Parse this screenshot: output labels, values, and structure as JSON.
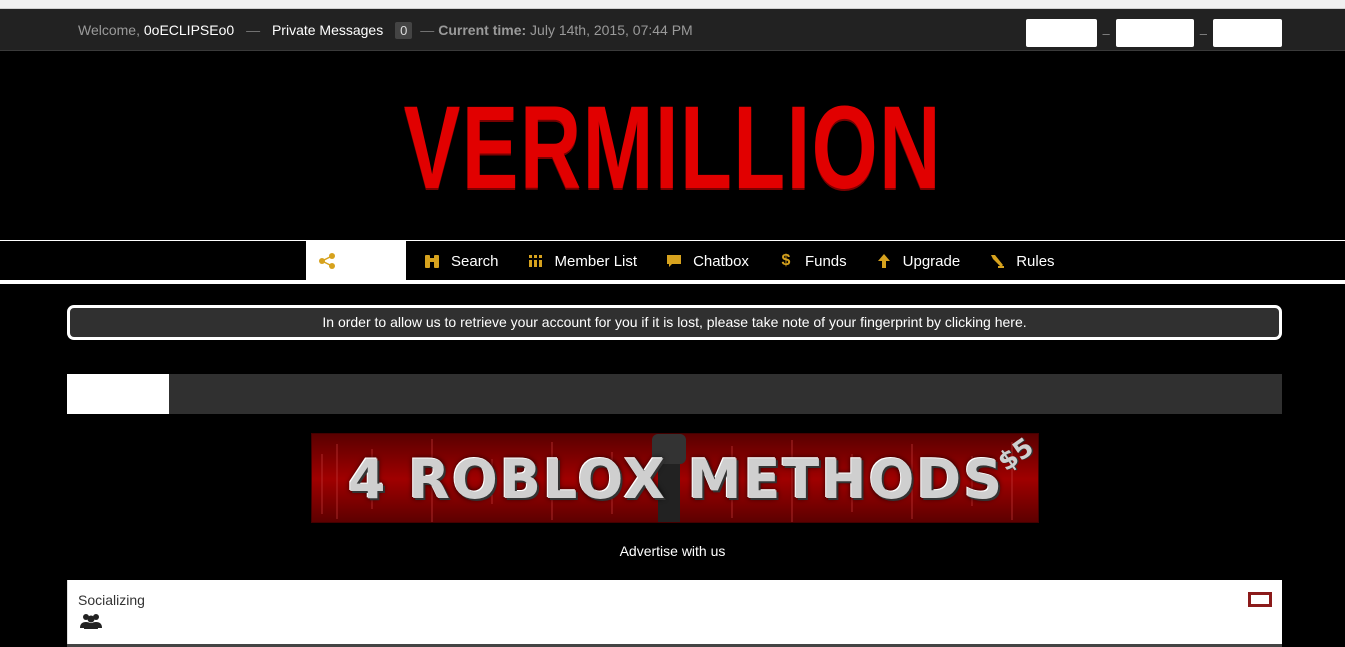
{
  "topbar": {
    "welcome_label": "Welcome, ",
    "username": "0oECLIPSEo0",
    "separator": "—",
    "pm_label": "Private Messages",
    "pm_count": "0",
    "time_label": "Current time:",
    "time_value": "July 14th, 2015, 07:44 PM",
    "btn_separator": "–"
  },
  "header": {
    "logo_text": "VERMILLION",
    "logo_color": "#e10000"
  },
  "nav": {
    "home_icon": "share-icon",
    "items": [
      {
        "label": "Search",
        "icon": "binoculars-icon"
      },
      {
        "label": "Member List",
        "icon": "grid-icon"
      },
      {
        "label": "Chatbox",
        "icon": "speech-bubble-icon"
      },
      {
        "label": "Funds",
        "icon": "dollar-icon"
      },
      {
        "label": "Upgrade",
        "icon": "arrow-up-icon"
      },
      {
        "label": "Rules",
        "icon": "gavel-icon"
      }
    ],
    "accent_color": "#d6a21e"
  },
  "notice": {
    "text": "In order to allow us to retrieve your account for you if it is lost, please take note of your fingerprint by clicking here."
  },
  "banner": {
    "text": "4 ROBLOX METHODS",
    "price": "$5",
    "background_color": "#8b0000"
  },
  "advertise": {
    "text": "Advertise with us"
  },
  "category": {
    "title": "Socializing",
    "icon": "users-icon",
    "collapse_color": "#8b1a1a"
  }
}
